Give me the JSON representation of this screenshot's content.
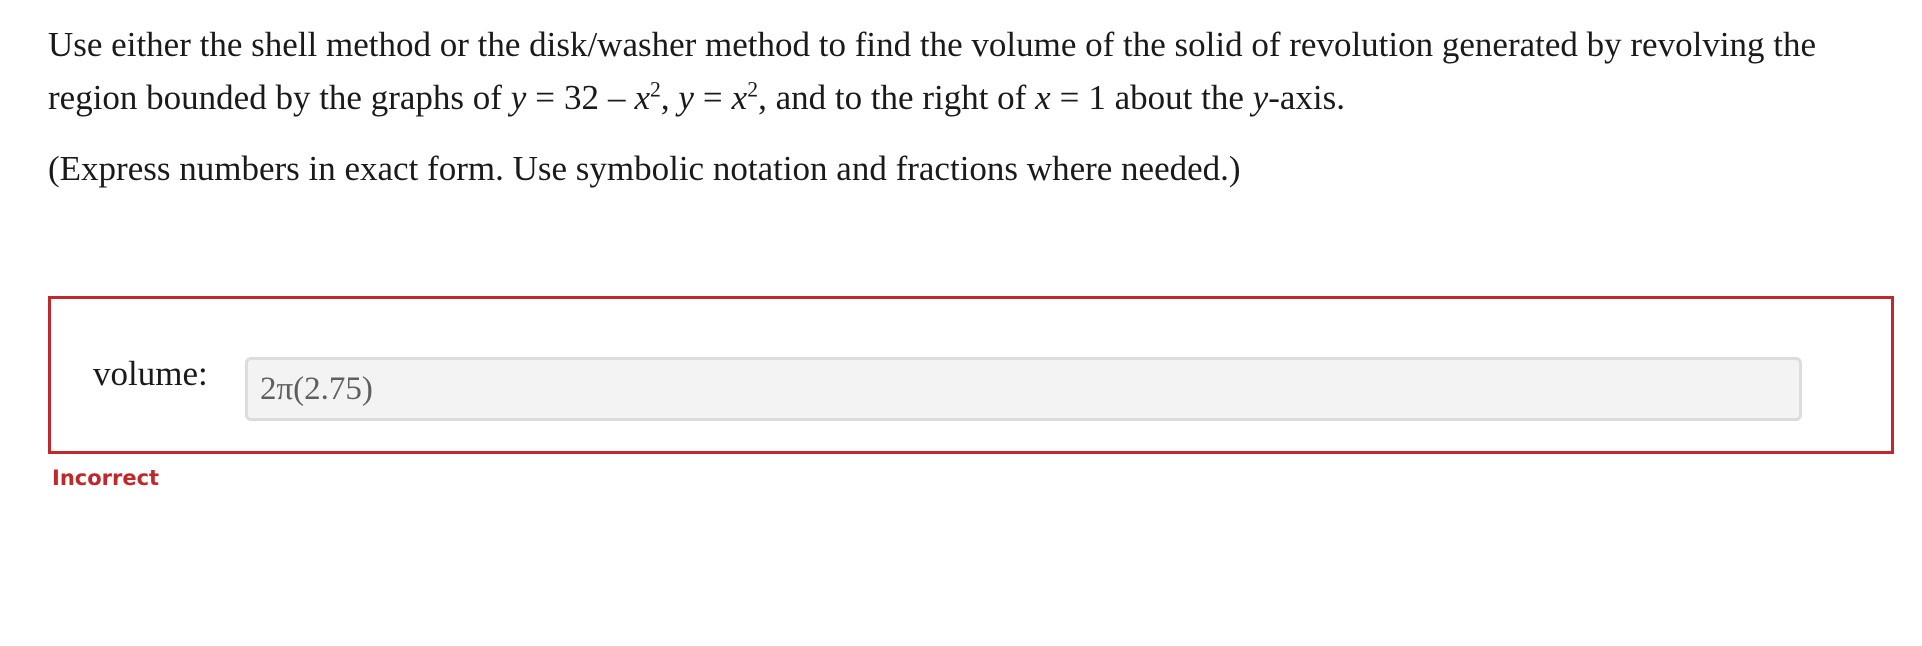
{
  "question": {
    "line1": "Use either the shell method or the disk/washer method to find the volume of the solid of revolution generated by revolving the",
    "line2_prefix": "region bounded by the graphs of ",
    "y1": "y",
    "eq1": "=",
    "rhs1_const": "32",
    "minus": "–",
    "rhs1_var": "x",
    "rhs1_exp": "2",
    "sep1": ", ",
    "y2": "y",
    "eq2": "=",
    "rhs2_var": "x",
    "rhs2_exp": "2",
    "mid_text": ", and to the right of ",
    "xvar": "x",
    "eq3": "=",
    "xval": "1",
    "about_text": " about the ",
    "axis_var": "y",
    "axis_suffix": "-axis.",
    "note": "(Express numbers in exact form. Use symbolic notation and fractions where needed.)"
  },
  "answer": {
    "label": "volume:",
    "value": "2π(2.75)"
  },
  "feedback": {
    "status": "Incorrect"
  },
  "colors": {
    "error": "#c0282b",
    "input_bg": "#f3f3f3",
    "input_border": "#dcdcdc"
  }
}
